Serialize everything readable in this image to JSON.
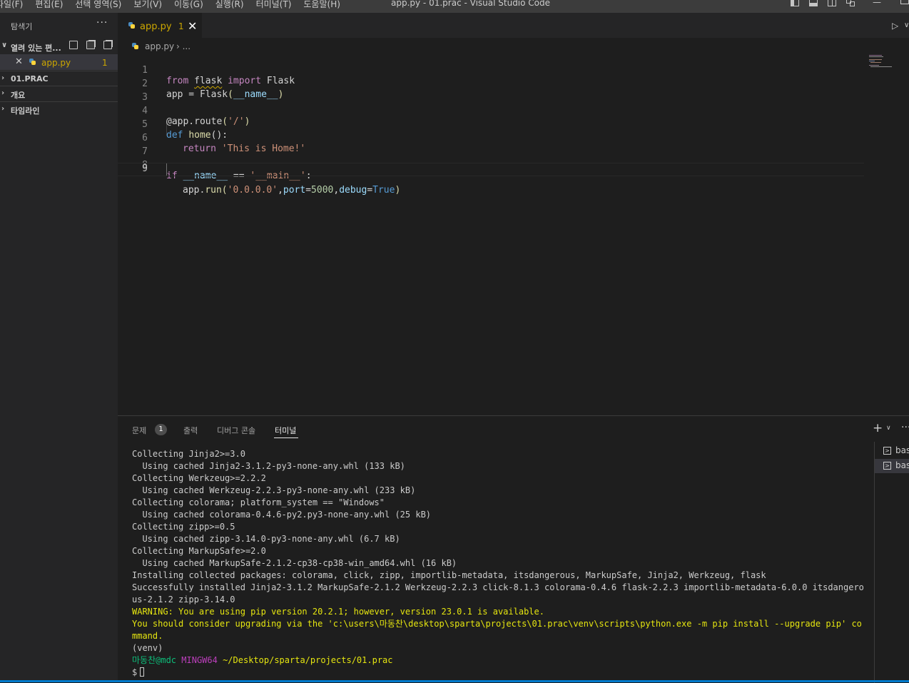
{
  "window": {
    "title": "app.py - 01.prac - Visual Studio Code",
    "menu": [
      "파일(F)",
      "편집(E)",
      "선택 영역(S)",
      "보기(V)",
      "이동(G)",
      "실행(R)",
      "터미널(T)",
      "도움말(H)"
    ],
    "minimize_glyph": "—"
  },
  "sidebar": {
    "title": "탐색기",
    "more_glyph": "···",
    "open_editors_label": "열려 있는 편...",
    "open_file": {
      "name": "app.py",
      "badge": "1",
      "close_glyph": "✕"
    },
    "sections": [
      "01.PRAC",
      "개요",
      "타임라인"
    ],
    "chevron_open": "∨",
    "chevron_closed": "›"
  },
  "tabs": [
    {
      "name": "app.py",
      "badge": "1",
      "close_glyph": "✕"
    }
  ],
  "run": {
    "play_glyph": "▷",
    "chevron_glyph": "∨"
  },
  "breadcrumb": {
    "file": "app.py",
    "separator": "› ..."
  },
  "editor": {
    "line_numbers": [
      "1",
      "2",
      "3",
      "4",
      "5",
      "6",
      "7",
      "8",
      "9"
    ],
    "code": {
      "l1": {
        "from": "from",
        "flask": "flask",
        "import": "import",
        "Flask": "Flask"
      },
      "l2": {
        "app": "app",
        "eq": " = ",
        "Flask": "Flask",
        "open": "(",
        "name": "__name__",
        "close": ")"
      },
      "l4": {
        "deco": "@app.route",
        "open": "(",
        "str": "'/'",
        "close": ")"
      },
      "l5": {
        "def": "def",
        "home": "home",
        "rest": "():"
      },
      "l6": {
        "return": "return",
        "str": "'This is Home!'"
      },
      "l8": {
        "if": "if",
        "name": "__name__",
        "eq": " == ",
        "str": "'__main__'",
        "colon": ":"
      },
      "l9": {
        "app": "app",
        "dot": ".",
        "run": "run",
        "open": "(",
        "host": "'0.0.0.0'",
        "comma1": ",",
        "port": "port",
        "eq1": "=",
        "portval": "5000",
        "comma2": ",",
        "debug": "debug",
        "eq2": "=",
        "true": "True",
        "close": ")"
      }
    }
  },
  "panel": {
    "tabs": {
      "problems": "문제",
      "problems_badge": "1",
      "output": "출력",
      "debug_console": "디버그 콘솔",
      "terminal": "터미널"
    },
    "plus_glyph": "+",
    "chevron_glyph": "∨",
    "more_glyph": "···",
    "terminal_lines": [
      "Collecting Jinja2>=3.0",
      "  Using cached Jinja2-3.1.2-py3-none-any.whl (133 kB)",
      "Collecting Werkzeug>=2.2.2",
      "  Using cached Werkzeug-2.2.3-py3-none-any.whl (233 kB)",
      "Collecting colorama; platform_system == \"Windows\"",
      "  Using cached colorama-0.4.6-py2.py3-none-any.whl (25 kB)",
      "Collecting zipp>=0.5",
      "  Using cached zipp-3.14.0-py3-none-any.whl (6.7 kB)",
      "Collecting MarkupSafe>=2.0",
      "  Using cached MarkupSafe-2.1.2-cp38-cp38-win_amd64.whl (16 kB)",
      "Installing collected packages: colorama, click, zipp, importlib-metadata, itsdangerous, MarkupSafe, Jinja2, Werkzeug, flask"
    ],
    "success_line": "Successfully installed Jinja2-3.1.2 MarkupSafe-2.1.2 Werkzeug-2.2.3 click-8.1.3 colorama-0.4.6 flask-2.2.3 importlib-metadata-6.0.0 itsdangerous-2.1.2 zipp-3.14.0",
    "warning_line": "WARNING: You are using pip version 20.2.1; however, version 23.0.1 is available.",
    "upgrade_line": "You should consider upgrading via the 'c:\\users\\마동찬\\desktop\\sparta\\projects\\01.prac\\venv\\scripts\\python.exe -m pip install --upgrade pip' command.",
    "venv_line": "(venv)",
    "prompt": {
      "user": "마동찬@mdc",
      "shell": "MINGW64",
      "path": "~/Desktop/sparta/projects/01.prac",
      "symbol": "$"
    },
    "terminal_list": [
      {
        "name": "bash",
        "icon_glyph": ">"
      },
      {
        "name": "bash",
        "icon_glyph": ">"
      }
    ]
  },
  "colors": {
    "accent": "#007acc",
    "modified_tab": "#cca700",
    "editor_bg": "#1e1e1e",
    "sidebar_bg": "#252526"
  }
}
